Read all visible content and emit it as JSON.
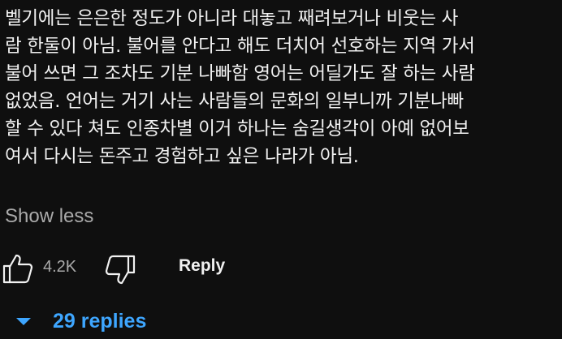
{
  "comment": {
    "lines": [
      "벨기에는 은은한 정도가 아니라 대놓고 째려보거나 비웃는 사",
      "람 한둘이 아님. 불어를 안다고 해도 더치어 선호하는 지역 가서",
      "불어 쓰면 그 조차도 기분 나빠함 영어는 어딜가도 잘 하는 사람",
      "없었음. 언어는 거기 사는 사람들의 문화의 일부니까 기분나빠",
      "할 수 있다 쳐도 인종차별 이거 하나는 숨길생각이 아예 없어보",
      "여서 다시는 돈주고 경험하고 싶은 나라가 아님."
    ],
    "show_less_label": "Show less"
  },
  "actions": {
    "like_icon": "thumbs-up-icon",
    "like_count": "4.2K",
    "dislike_icon": "thumbs-down-icon",
    "reply_label": "Reply"
  },
  "replies": {
    "toggle_icon": "caret-down-icon",
    "label": "29 replies",
    "accent_color": "#3ea6ff"
  }
}
